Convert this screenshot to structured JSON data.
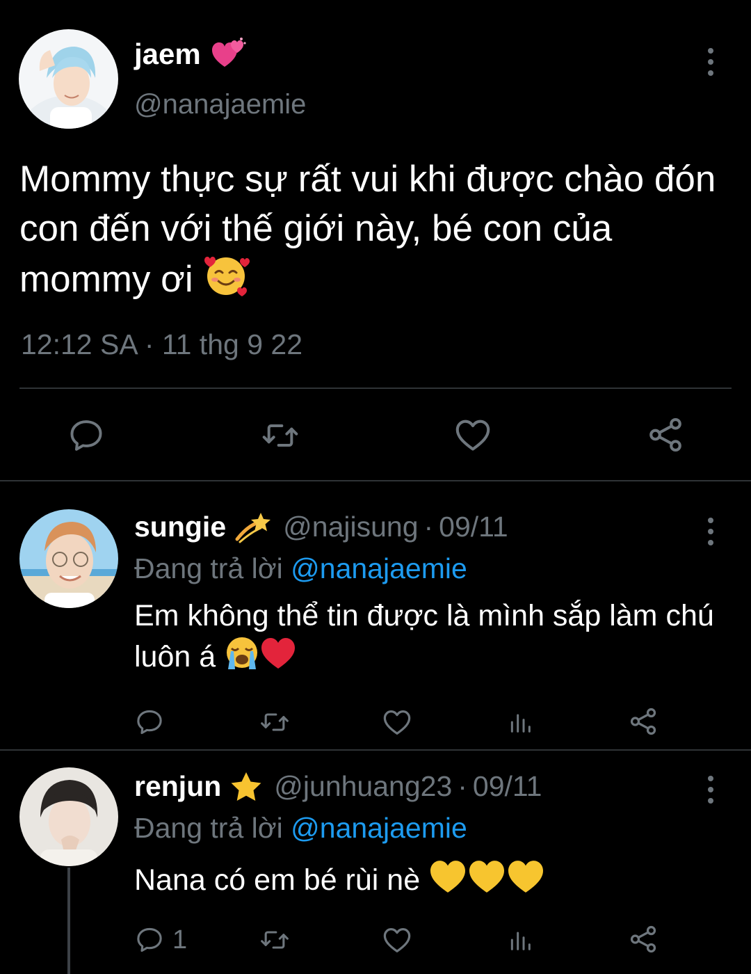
{
  "main_tweet": {
    "display_name": "jaem",
    "name_emoji": "two-hearts-emoji",
    "handle": "@nanajaemie",
    "text": "Mommy thực sự rất vui khi được chào đón con đến với thế giới này, bé con của mommy ơi",
    "text_emoji": "smiling-face-with-hearts-emoji",
    "timestamp": "12:12 SA · 11 thg 9 22",
    "actions": [
      "reply-icon",
      "retweet-icon",
      "like-icon",
      "share-icon"
    ]
  },
  "replies": [
    {
      "display_name": "sungie",
      "name_emoji": "dizzy-emoji",
      "handle": "@najisung",
      "date": "09/11",
      "separator": "·",
      "replying_label": "Đang trả lời",
      "replying_to": "@nanajaemie",
      "text": "Em không thể tin được là mình sắp làm chú luôn á",
      "text_emojis": [
        "loudly-crying-face-emoji",
        "red-heart-emoji"
      ],
      "reply_count": "",
      "actions": [
        "reply-icon",
        "retweet-icon",
        "like-icon",
        "analytics-icon",
        "share-icon"
      ]
    },
    {
      "display_name": "renjun",
      "name_emoji": "star-emoji",
      "handle": "@junhuang23",
      "date": "09/11",
      "separator": "·",
      "replying_label": "Đang trả lời",
      "replying_to": "@nanajaemie",
      "text": "Nana có em bé rùi nè",
      "text_emojis": [
        "yellow-heart-emoji",
        "yellow-heart-emoji",
        "yellow-heart-emoji"
      ],
      "reply_count": "1",
      "actions": [
        "reply-icon",
        "retweet-icon",
        "like-icon",
        "analytics-icon",
        "share-icon"
      ]
    }
  ],
  "colors": {
    "background": "#000000",
    "text": "#ffffff",
    "secondary": "#6e767d",
    "mention": "#1d9bf0",
    "divider": "#2f3336"
  }
}
